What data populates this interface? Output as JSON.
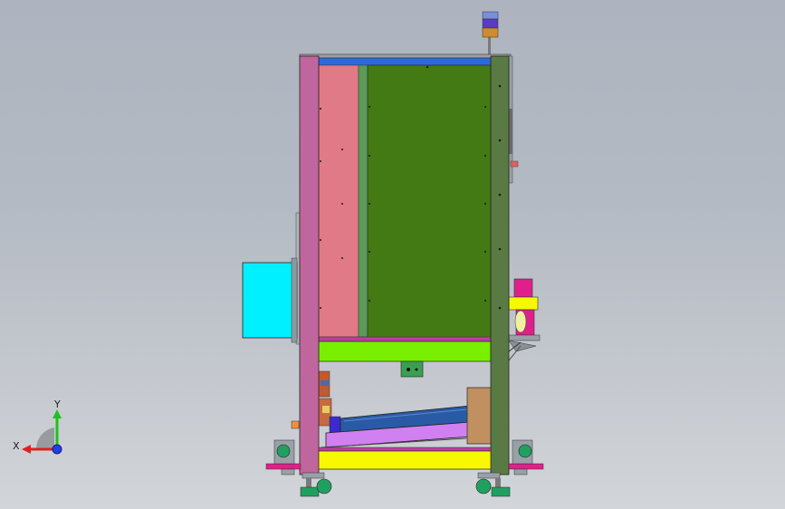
{
  "triad": {
    "x_label": "X",
    "y_label": "Y"
  },
  "colors": {
    "background_top": "#aeb4bf",
    "background_bottom": "#d2d5d9",
    "left_column": "#c0669e",
    "right_column": "#5a7a44",
    "green_panel": "#447a14",
    "pink_panel": "#e07a86",
    "cyan_box": "#00f0ff",
    "lime_beam": "#78f000",
    "yellow_base": "#f8f800",
    "blue_trough": "#2a5aa6",
    "violet_trough": "#d080f0",
    "tan_box": "#c09060",
    "magenta_foot": "#e0208a",
    "wheel_green": "#20a060",
    "top_blue_bar": "#2a6ae0"
  }
}
